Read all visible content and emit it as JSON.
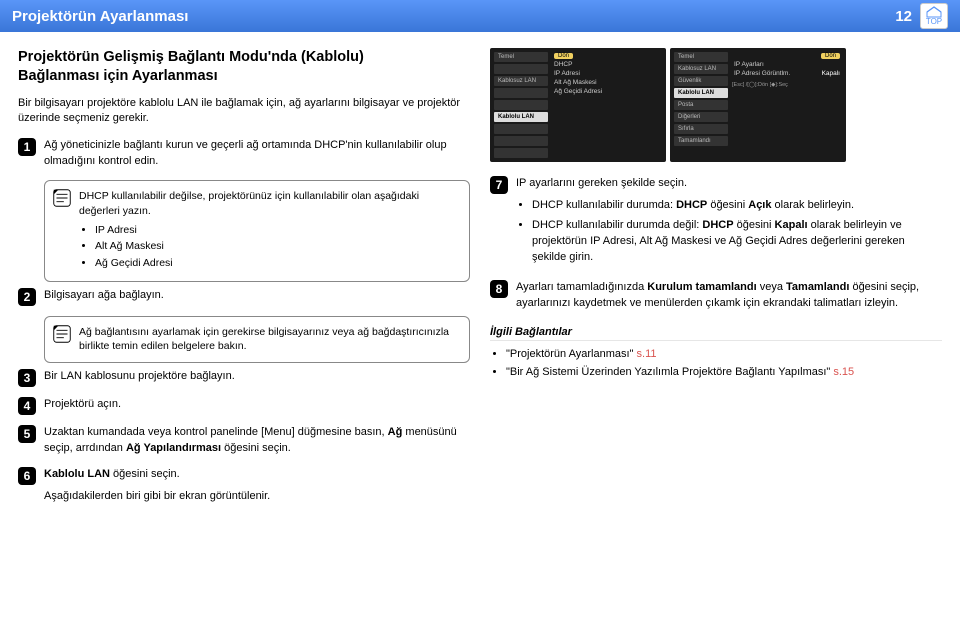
{
  "header": {
    "title": "Projektörün Ayarlanması",
    "page": "12",
    "top_label": "TOP"
  },
  "section_title_l1": "Projektörün Gelişmiş Bağlantı Modu'nda (Kablolu)",
  "section_title_l2": "Bağlanması için Ayarlanması",
  "intro": "Bir bilgisayarı projektöre kablolu LAN ile bağlamak için, ağ ayarlarını bilgisayar ve projektör üzerinde seçmeniz gerekir.",
  "steps": {
    "s1": "Ağ yöneticinizle bağlantı kurun ve geçerli ağ ortamında DHCP'nin kullanılabilir olup olmadığını kontrol edin.",
    "note1_intro": "DHCP kullanılabilir değilse, projektörünüz için kullanılabilir olan aşağıdaki değerleri yazın.",
    "note1_b1": "IP Adresi",
    "note1_b2": "Alt Ağ Maskesi",
    "note1_b3": "Ağ Geçidi Adresi",
    "s2": "Bilgisayarı ağa bağlayın.",
    "note2": "Ağ bağlantısını ayarlamak için gerekirse bilgisayarınız veya ağ bağdaştırıcınızla birlikte temin edilen belgelere bakın.",
    "s3": "Bir LAN kablosunu projektöre bağlayın.",
    "s4": "Projektörü açın.",
    "s5_a": "Uzaktan kumandada veya kontrol panelinde [Menu] düğmesine basın, ",
    "s5_b": "Ağ",
    "s5_c": " menüsünü seçip, arrdından ",
    "s5_d": "Ağ Yapılandırması",
    "s5_e": " öğesini seçin.",
    "s6_a": "Kablolu LAN",
    "s6_b": " öğesini seçin.",
    "s6_sub": "Aşağıdakilerden biri gibi bir ekran görüntülenir.",
    "s7": "IP ayarlarını gereken şekilde seçin.",
    "s7_b1_a": "DHCP kullanılabilir durumda: ",
    "s7_b1_b": "DHCP",
    "s7_b1_c": " öğesini ",
    "s7_b1_d": "Açık",
    "s7_b1_e": " olarak belirleyin.",
    "s7_b2_a": "DHCP kullanılabilir durumda değil: ",
    "s7_b2_b": "DHCP",
    "s7_b2_c": " öğesini ",
    "s7_b2_d": "Kapalı",
    "s7_b2_e": " olarak belirleyin ve projektörün IP Adresi, Alt Ağ Maskesi ve Ağ Geçidi Adres değerlerini gereken şekilde girin.",
    "s8_a": "Ayarları tamamladığınızda ",
    "s8_b": "Kurulum tamamlandı",
    "s8_c": " veya ",
    "s8_d": "Tamamlandı",
    "s8_e": " öğesini seçip, ayarlarınızı kaydetmek ve menülerden çıkamk için ekrandaki talimatları izleyin."
  },
  "related": {
    "title": "İlgili Bağlantılar",
    "r1_text": "\"Projektörün Ayarlanması\"",
    "r1_page": "s.11",
    "r2_text": "\"Bir Ağ Sistemi Üzerinden Yazılımla Projektöre Bağlantı Yapılması\"",
    "r2_page": "s.15"
  },
  "osd1": {
    "side": [
      "Temel",
      "",
      "Kablosuz LAN",
      "",
      "",
      "Kablolu LAN",
      "",
      "",
      ""
    ],
    "row1": [
      "",
      "DHCP"
    ],
    "row2": [
      "IP Adresi"
    ],
    "row3": [
      "Alt Ağ Maskesi"
    ],
    "row4": [
      "Ağ Geçidi Adresi"
    ],
    "footer": ""
  },
  "osd2": {
    "side": [
      "Temel",
      "Kablosuz LAN",
      "Güvenlik",
      "Kablolu LAN",
      "Posta",
      "Diğerleri",
      "Sıfırla",
      "Tamamlandı"
    ],
    "row1_l": "IP Ayarları",
    "row1_r": "",
    "row2_l": "IP Adresi Görüntlm.",
    "row2_r": "Kapalı",
    "btn": "Dön",
    "footer": "[Esc] /[◯]:Dön  [◆]:Seç"
  }
}
